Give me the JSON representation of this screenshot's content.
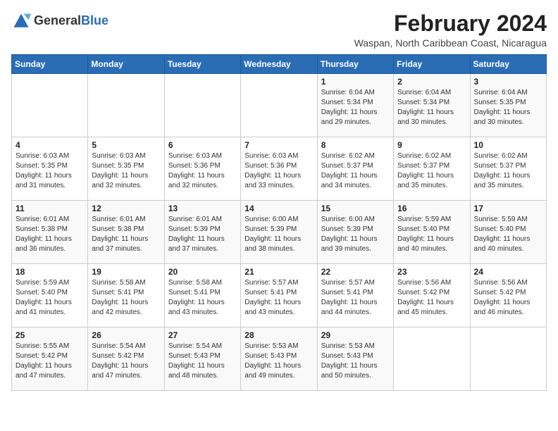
{
  "logo": {
    "general": "General",
    "blue": "Blue"
  },
  "title": {
    "month_year": "February 2024",
    "location": "Waspan, North Caribbean Coast, Nicaragua"
  },
  "weekdays": [
    "Sunday",
    "Monday",
    "Tuesday",
    "Wednesday",
    "Thursday",
    "Friday",
    "Saturday"
  ],
  "weeks": [
    [
      {
        "day": "",
        "info": ""
      },
      {
        "day": "",
        "info": ""
      },
      {
        "day": "",
        "info": ""
      },
      {
        "day": "",
        "info": ""
      },
      {
        "day": "1",
        "info": "Sunrise: 6:04 AM\nSunset: 5:34 PM\nDaylight: 11 hours\nand 29 minutes."
      },
      {
        "day": "2",
        "info": "Sunrise: 6:04 AM\nSunset: 5:34 PM\nDaylight: 11 hours\nand 30 minutes."
      },
      {
        "day": "3",
        "info": "Sunrise: 6:04 AM\nSunset: 5:35 PM\nDaylight: 11 hours\nand 30 minutes."
      }
    ],
    [
      {
        "day": "4",
        "info": "Sunrise: 6:03 AM\nSunset: 5:35 PM\nDaylight: 11 hours\nand 31 minutes."
      },
      {
        "day": "5",
        "info": "Sunrise: 6:03 AM\nSunset: 5:35 PM\nDaylight: 11 hours\nand 32 minutes."
      },
      {
        "day": "6",
        "info": "Sunrise: 6:03 AM\nSunset: 5:36 PM\nDaylight: 11 hours\nand 32 minutes."
      },
      {
        "day": "7",
        "info": "Sunrise: 6:03 AM\nSunset: 5:36 PM\nDaylight: 11 hours\nand 33 minutes."
      },
      {
        "day": "8",
        "info": "Sunrise: 6:02 AM\nSunset: 5:37 PM\nDaylight: 11 hours\nand 34 minutes."
      },
      {
        "day": "9",
        "info": "Sunrise: 6:02 AM\nSunset: 5:37 PM\nDaylight: 11 hours\nand 35 minutes."
      },
      {
        "day": "10",
        "info": "Sunrise: 6:02 AM\nSunset: 5:37 PM\nDaylight: 11 hours\nand 35 minutes."
      }
    ],
    [
      {
        "day": "11",
        "info": "Sunrise: 6:01 AM\nSunset: 5:38 PM\nDaylight: 11 hours\nand 36 minutes."
      },
      {
        "day": "12",
        "info": "Sunrise: 6:01 AM\nSunset: 5:38 PM\nDaylight: 11 hours\nand 37 minutes."
      },
      {
        "day": "13",
        "info": "Sunrise: 6:01 AM\nSunset: 5:39 PM\nDaylight: 11 hours\nand 37 minutes."
      },
      {
        "day": "14",
        "info": "Sunrise: 6:00 AM\nSunset: 5:39 PM\nDaylight: 11 hours\nand 38 minutes."
      },
      {
        "day": "15",
        "info": "Sunrise: 6:00 AM\nSunset: 5:39 PM\nDaylight: 11 hours\nand 39 minutes."
      },
      {
        "day": "16",
        "info": "Sunrise: 5:59 AM\nSunset: 5:40 PM\nDaylight: 11 hours\nand 40 minutes."
      },
      {
        "day": "17",
        "info": "Sunrise: 5:59 AM\nSunset: 5:40 PM\nDaylight: 11 hours\nand 40 minutes."
      }
    ],
    [
      {
        "day": "18",
        "info": "Sunrise: 5:59 AM\nSunset: 5:40 PM\nDaylight: 11 hours\nand 41 minutes."
      },
      {
        "day": "19",
        "info": "Sunrise: 5:58 AM\nSunset: 5:41 PM\nDaylight: 11 hours\nand 42 minutes."
      },
      {
        "day": "20",
        "info": "Sunrise: 5:58 AM\nSunset: 5:41 PM\nDaylight: 11 hours\nand 43 minutes."
      },
      {
        "day": "21",
        "info": "Sunrise: 5:57 AM\nSunset: 5:41 PM\nDaylight: 11 hours\nand 43 minutes."
      },
      {
        "day": "22",
        "info": "Sunrise: 5:57 AM\nSunset: 5:41 PM\nDaylight: 11 hours\nand 44 minutes."
      },
      {
        "day": "23",
        "info": "Sunrise: 5:56 AM\nSunset: 5:42 PM\nDaylight: 11 hours\nand 45 minutes."
      },
      {
        "day": "24",
        "info": "Sunrise: 5:56 AM\nSunset: 5:42 PM\nDaylight: 11 hours\nand 46 minutes."
      }
    ],
    [
      {
        "day": "25",
        "info": "Sunrise: 5:55 AM\nSunset: 5:42 PM\nDaylight: 11 hours\nand 47 minutes."
      },
      {
        "day": "26",
        "info": "Sunrise: 5:54 AM\nSunset: 5:42 PM\nDaylight: 11 hours\nand 47 minutes."
      },
      {
        "day": "27",
        "info": "Sunrise: 5:54 AM\nSunset: 5:43 PM\nDaylight: 11 hours\nand 48 minutes."
      },
      {
        "day": "28",
        "info": "Sunrise: 5:53 AM\nSunset: 5:43 PM\nDaylight: 11 hours\nand 49 minutes."
      },
      {
        "day": "29",
        "info": "Sunrise: 5:53 AM\nSunset: 5:43 PM\nDaylight: 11 hours\nand 50 minutes."
      },
      {
        "day": "",
        "info": ""
      },
      {
        "day": "",
        "info": ""
      }
    ]
  ]
}
